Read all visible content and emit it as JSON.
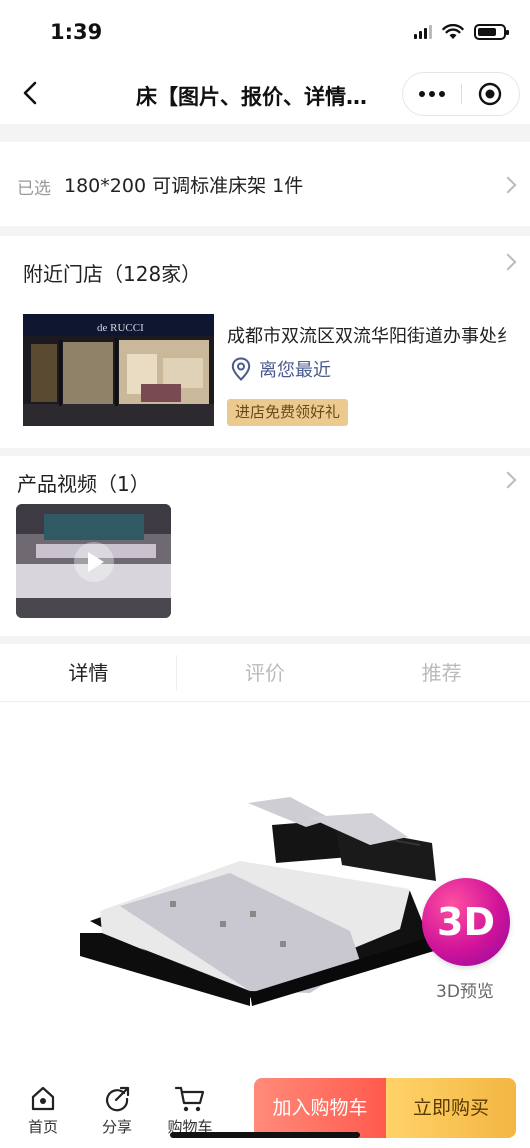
{
  "status_bar": {
    "time": "1:39"
  },
  "nav": {
    "title": "床【图片、报价、详情…"
  },
  "selected": {
    "label": "已选",
    "value": "180*200 可调标准床架 1件"
  },
  "stores": {
    "title": "附近门店（128家）",
    "address": "成都市双流区双流华阳街道办事处纟",
    "nearest": "离您最近",
    "gift_tag": "进店免费领好礼",
    "image_sign_text": "de RUCCI"
  },
  "videos": {
    "title": "产品视频（1）"
  },
  "tabs": [
    {
      "label": "详情",
      "active": true
    },
    {
      "label": "评价",
      "active": false
    },
    {
      "label": "推荐",
      "active": false
    }
  ],
  "product": {
    "badge_3d": "3D",
    "preview_label": "3D预览"
  },
  "bottom_bar": {
    "home": "首页",
    "share": "分享",
    "cart": "购物车",
    "add_to_cart": "加入购物车",
    "buy_now": "立即购买"
  },
  "colors": {
    "accent_cart": "#ff5a4d",
    "accent_buy": "#f3b642",
    "location_blue": "#4a5a8c",
    "badge_3d": "#d0139a"
  }
}
